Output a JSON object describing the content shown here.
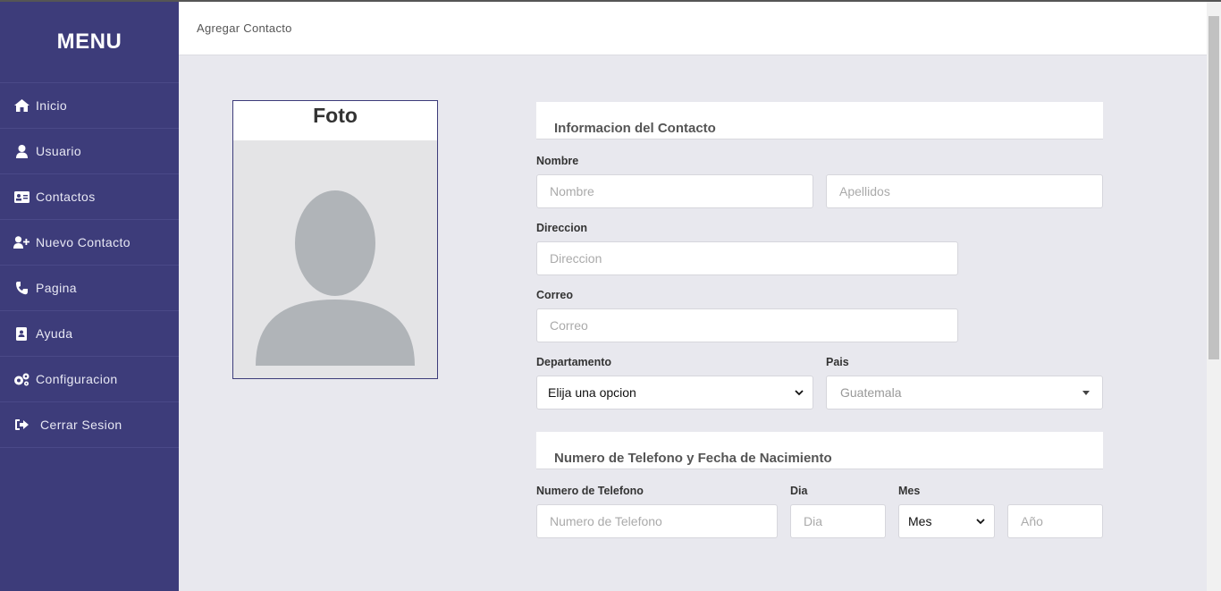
{
  "sidebar": {
    "title": "MENU",
    "items": [
      {
        "label": "Inicio",
        "icon": "home-icon"
      },
      {
        "label": "Usuario",
        "icon": "user-icon"
      },
      {
        "label": "Contactos",
        "icon": "address-card-icon"
      },
      {
        "label": "Nuevo Contacto",
        "icon": "user-plus-icon"
      },
      {
        "label": "Pagina",
        "icon": "phone-icon"
      },
      {
        "label": "Ayuda",
        "icon": "address-book-icon"
      },
      {
        "label": "Configuracion",
        "icon": "gears-icon"
      },
      {
        "label": "Cerrar Sesion",
        "icon": "sign-out-icon"
      }
    ]
  },
  "topbar": {
    "breadcrumb": "Agregar Contacto"
  },
  "photo": {
    "title": "Foto"
  },
  "contact_info": {
    "header": "Informacion del Contacto",
    "nombre_label": "Nombre",
    "nombre_placeholder": "Nombre",
    "apellidos_placeholder": "Apellidos",
    "direccion_label": "Direccion",
    "direccion_placeholder": "Direccion",
    "correo_label": "Correo",
    "correo_placeholder": "Correo",
    "departamento_label": "Departamento",
    "departamento_value": "Elija una opcion",
    "pais_label": "Pais",
    "pais_value": "Guatemala"
  },
  "phone_birth": {
    "header": "Numero de Telefono y Fecha de Nacimiento",
    "telefono_label": "Numero de Telefono",
    "telefono_placeholder": "Numero de Telefono",
    "dia_label": "Dia",
    "dia_placeholder": "Dia",
    "mes_label": "Mes",
    "mes_value": "Mes",
    "anio_placeholder": "Año"
  },
  "colors": {
    "sidebar": "#3d3c7a",
    "background": "#e8e8ee"
  }
}
